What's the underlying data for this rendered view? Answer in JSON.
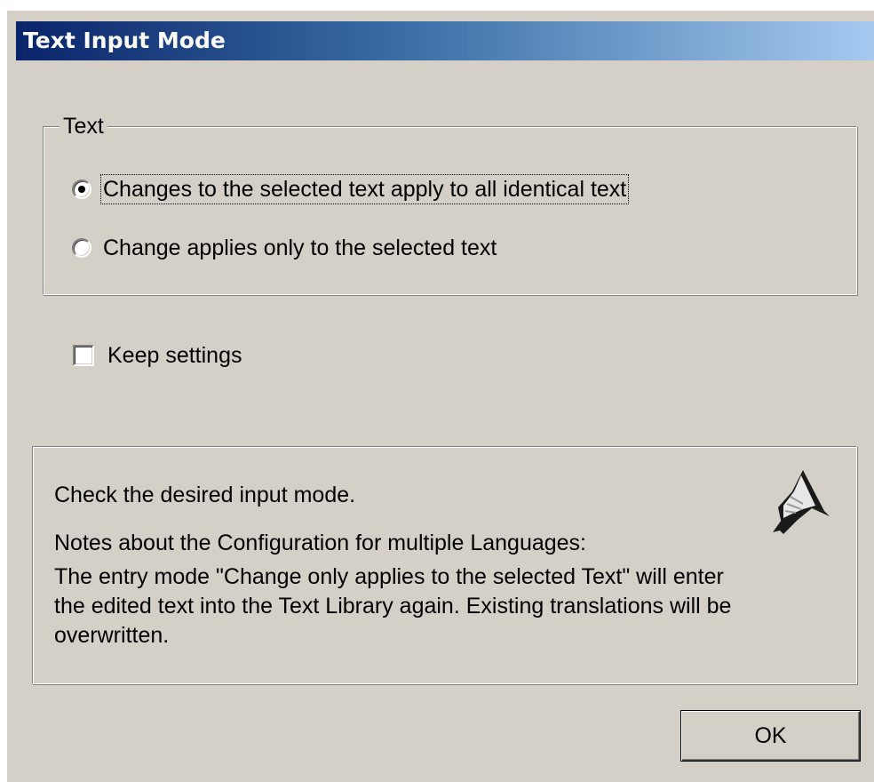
{
  "window": {
    "title": "Text Input Mode"
  },
  "text_group": {
    "legend": "Text",
    "options": [
      {
        "label": "Changes to the selected text apply to all identical text",
        "selected": true
      },
      {
        "label": "Change applies only to the selected text",
        "selected": false
      }
    ]
  },
  "keep_settings": {
    "label": "Keep settings",
    "checked": false
  },
  "info": {
    "line1": "Check the desired input mode.",
    "line2": "Notes about the Configuration for multiple Languages:",
    "line3": "The entry mode \"Change only applies to the selected Text\" will enter",
    "line4": "the edited text into the Text Library again. Existing translations will be",
    "line5": "overwritten.",
    "icon": "wizard-hat-icon"
  },
  "buttons": {
    "ok_label": "OK"
  },
  "colors": {
    "dialog_background": "#d4d0c8",
    "title_gradient_start": "#0a246a",
    "title_gradient_end": "#a6caf0",
    "title_text": "#ffffff"
  }
}
